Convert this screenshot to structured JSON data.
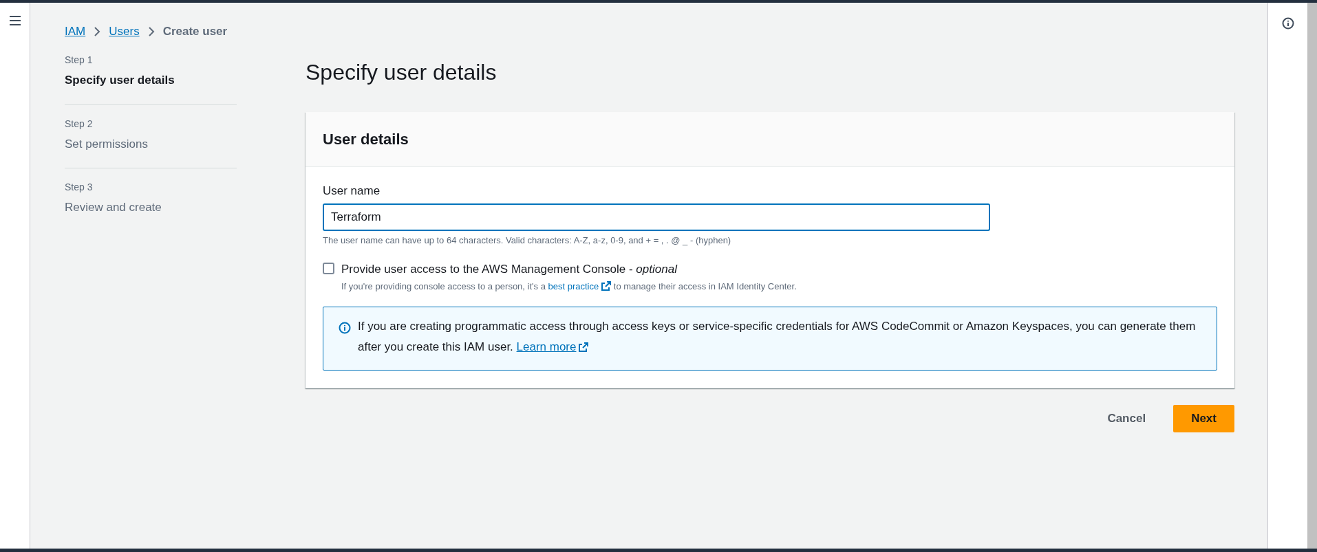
{
  "breadcrumbs": [
    {
      "label": "IAM",
      "kind": "link"
    },
    {
      "label": "Users",
      "kind": "link"
    },
    {
      "label": "Create user",
      "kind": "current"
    }
  ],
  "steps": [
    {
      "step": "Step 1",
      "title": "Specify user details",
      "selected": true
    },
    {
      "step": "Step 2",
      "title": "Set permissions",
      "selected": false
    },
    {
      "step": "Step 3",
      "title": "Review and create",
      "selected": false
    }
  ],
  "page_title": "Specify user details",
  "card": {
    "title": "User details",
    "user_name": {
      "label": "User name",
      "value": "Terraform",
      "hint": "The user name can have up to 64 characters. Valid characters: A-Z, a-z, 0-9, and + = , . @ _ - (hyphen)"
    },
    "console_access": {
      "label": "Provide user access to the AWS Management Console - *optional*",
      "checked": false,
      "text_before": "If you're providing console access to a person, it's a",
      "link": "best practice",
      "text_after": "to manage their access in IAM Identity Center."
    },
    "info": {
      "text": "If you are creating programmatic access through access keys or service-specific credentials for AWS CodeCommit or Amazon Keyspaces, you can generate them after you create this IAM user.",
      "link": "Learn more"
    }
  },
  "buttons": [
    {
      "label": "Cancel",
      "kind": "secondary"
    },
    {
      "label": "Next",
      "kind": "primary"
    }
  ]
}
